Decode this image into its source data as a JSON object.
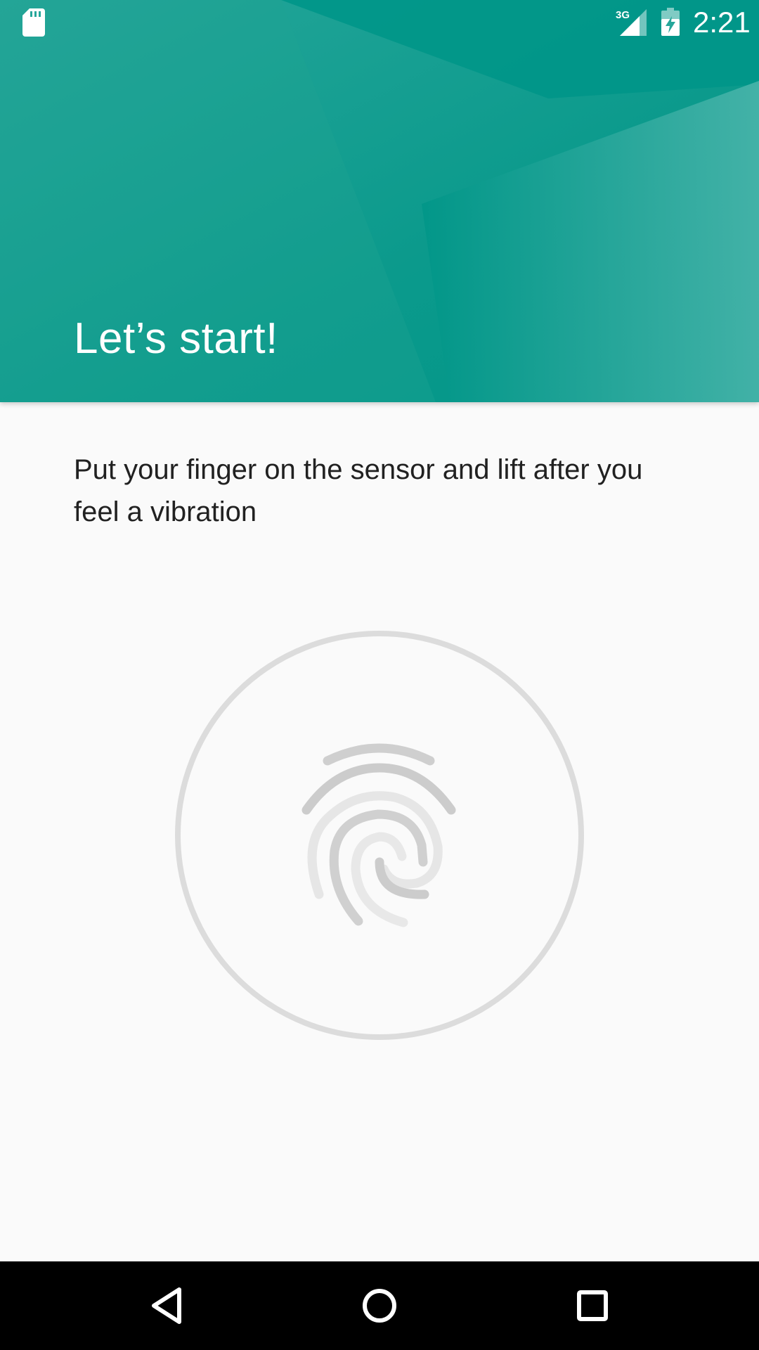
{
  "status_bar": {
    "time": "2:21",
    "network_type": "3G",
    "left_icon": "sd-card-icon",
    "signal_icon": "cell-signal-icon",
    "battery_icon": "battery-charging-icon"
  },
  "header": {
    "title": "Let’s start!",
    "background_color": "#009688"
  },
  "body": {
    "instruction": "Put your finger on the sensor and lift after you feel a vibration",
    "sensor_icon": "fingerprint-icon",
    "progress_ring_color": "#dcdcdc"
  },
  "nav_bar": {
    "back_icon": "back-triangle-icon",
    "home_icon": "home-circle-icon",
    "recents_icon": "recents-square-icon"
  }
}
